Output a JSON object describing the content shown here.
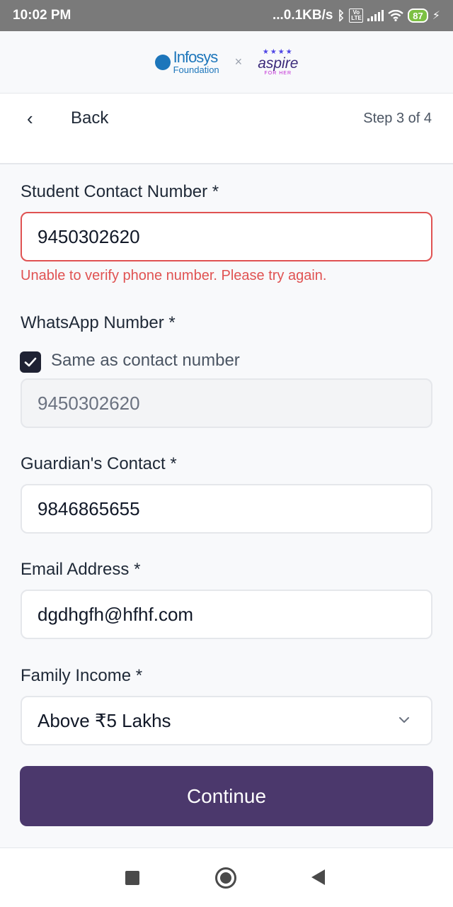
{
  "status_bar": {
    "time": "10:02 PM",
    "net_speed": "...0.1KB/s",
    "battery": "87",
    "network_badge": "Vo LTE",
    "icons": [
      "bluetooth-icon",
      "signal-icon",
      "wifi-icon",
      "battery-icon",
      "charging-icon"
    ]
  },
  "brand": {
    "partner_name": "Infosys",
    "partner_sub": "Foundation",
    "separator": "×",
    "program_name": "aspire",
    "program_sub": "FOR HER"
  },
  "header": {
    "back_label": "Back",
    "step_label": "Step 3 of 4"
  },
  "form": {
    "student_contact": {
      "label": "Student Contact Number *",
      "value": "9450302620",
      "error": "Unable to verify phone number. Please try again."
    },
    "whatsapp": {
      "label": "WhatsApp Number *",
      "checkbox_label": "Same as contact number",
      "checked": true,
      "value": "9450302620"
    },
    "guardian_contact": {
      "label": "Guardian's Contact *",
      "value": "9846865655"
    },
    "email": {
      "label": "Email Address *",
      "value": "dgdhgfh@hfhf.com"
    },
    "family_income": {
      "label": "Family Income *",
      "value": "Above ₹5 Lakhs"
    }
  },
  "continue_label": "Continue",
  "colors": {
    "primary": "#4b386c",
    "error": "#e05252",
    "checkbox": "#1f2233"
  }
}
